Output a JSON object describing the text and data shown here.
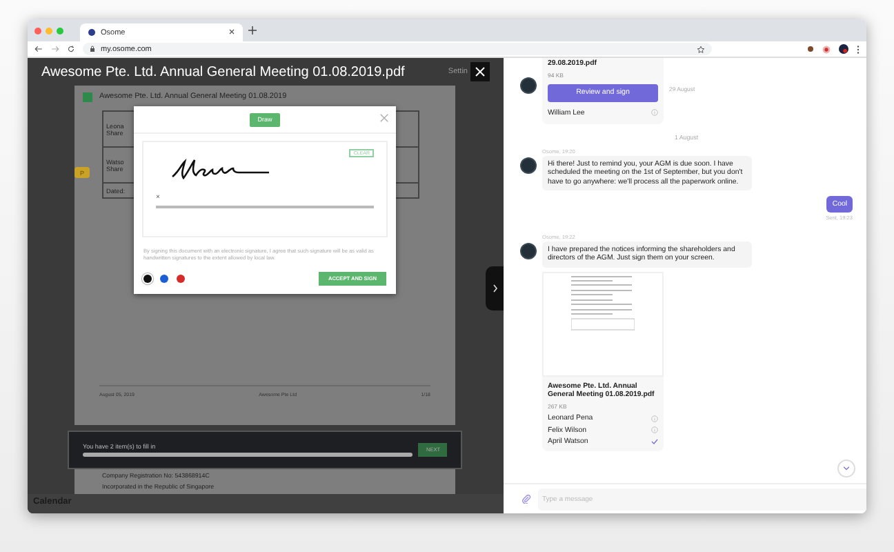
{
  "browser": {
    "tab_title": "Osome",
    "url": "my.osome.com"
  },
  "viewer": {
    "title": "Awesome Pte. Ltd. Annual General Meeting 01.08.2019.pdf",
    "settings_label": "Settin",
    "marker": "P",
    "document": {
      "header": "Awesome Pte. Ltd. Annual General Meeting 01.08.2019",
      "table_rows": [
        {
          "name": "Leona",
          "role": "Share"
        },
        {
          "name": "Watso",
          "role": "Share"
        }
      ],
      "dated_label": "Dated:",
      "footer": [
        "August 05, 2019",
        "Awesome Pte Ltd",
        "1/18"
      ]
    },
    "fill_bar": {
      "text": "You have 2 item(s) to fill in",
      "button": "NEXT"
    },
    "next_page_lines": [
      "Company Registration No: 543868914C",
      "Incorporated in the Republic of Singapore"
    ],
    "calendar_label": "Calendar"
  },
  "modal": {
    "mode_tab": "Draw",
    "clear_button": "CLEAR",
    "sign_mark": "×",
    "disclaimer": "By signing this document with an electronic signature, I agree that such signature will be as valid as handwritten signatures to the extent allowed by local law.",
    "pen_colors": [
      {
        "color": "#111111",
        "selected": true
      },
      {
        "color": "#1a5fd6",
        "selected": false
      },
      {
        "color": "#d62b2b",
        "selected": false
      }
    ],
    "accept_button": "ACCEPT AND SIGN"
  },
  "chat": {
    "messages": [
      {
        "kind": "file_card",
        "file_name": "29.08.2019.pdf",
        "size": "94 KB",
        "action": "Review and sign",
        "signers": [
          {
            "name": "William Lee",
            "signed": false
          }
        ],
        "date": "29 August"
      },
      {
        "kind": "divider",
        "text": "1 August"
      },
      {
        "kind": "incoming",
        "meta": "Osome, 19:20",
        "text": "Hi there! Just to remind you, your AGM is due soon. I have scheduled the meeting on the 1st of September, but you don't have to go anywhere: we'll process all the paperwork online."
      },
      {
        "kind": "outgoing",
        "text": "Cool",
        "meta": "Sent, 19:23"
      },
      {
        "kind": "incoming",
        "meta": "Osome, 19:22",
        "text": "I have prepared the notices informing the shareholders and directors of the AGM. Just sign them on your screen.",
        "attachment": {
          "file_name": "Awesome Pte. Ltd. Annual General Meeting 01.08.2019.pdf",
          "size": "267 KB",
          "signers": [
            {
              "name": "Leonard Pena",
              "signed": false
            },
            {
              "name": "Felix Wilson",
              "signed": false
            },
            {
              "name": "April Watson",
              "signed": true
            }
          ]
        }
      }
    ],
    "input_placeholder": "Type a message"
  }
}
